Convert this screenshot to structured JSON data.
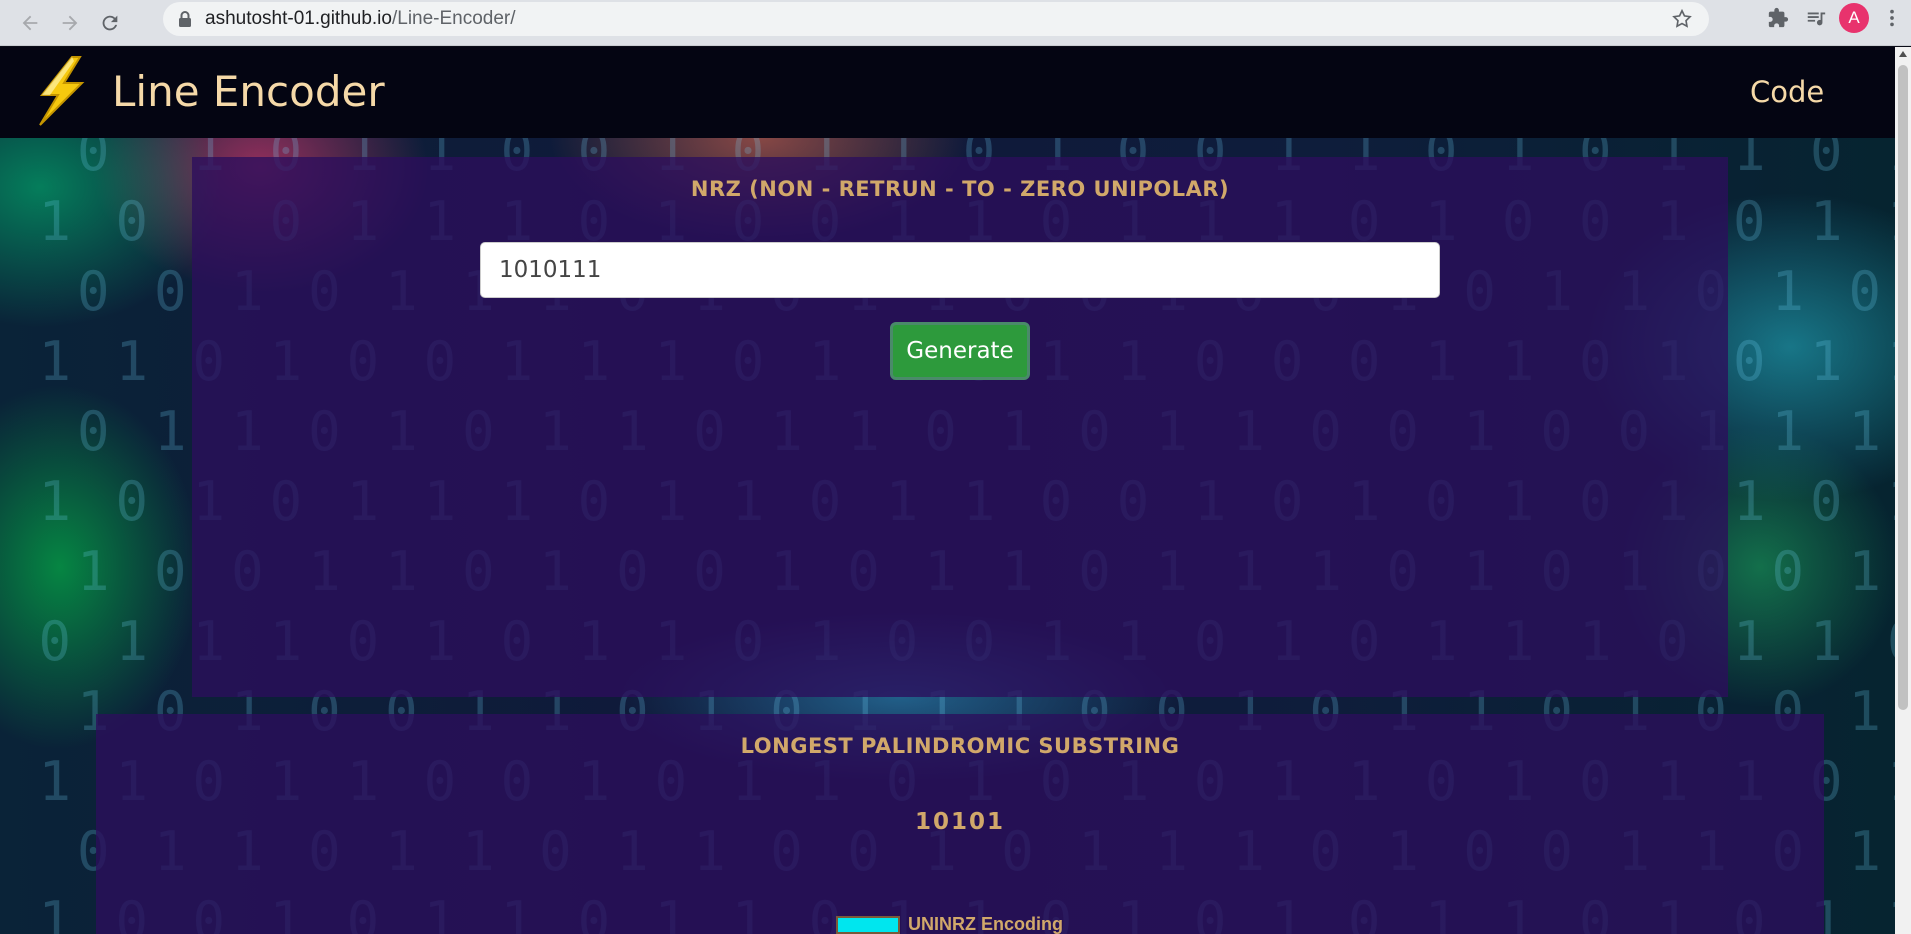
{
  "browser": {
    "url_host": "ashutosht-01.github.io",
    "url_path": "/Line-Encoder/",
    "avatar_letter": "A"
  },
  "navbar": {
    "brand": "Line Encoder",
    "code_link": "Code"
  },
  "encoder": {
    "heading": "NRZ (NON - RETRUN - TO - ZERO UNIPOLAR)",
    "input_value": "1010111",
    "generate_label": "Generate"
  },
  "palindrome": {
    "heading": "LONGEST PALINDROMIC SUBSTRING",
    "result": "10101",
    "legend_label": "UNINRZ Encoding",
    "legend_color": "#00e6ee"
  },
  "colors": {
    "accent_text": "#d1a86a",
    "brand_text": "#f5d9a8",
    "button_green": "#2d9a3c",
    "panel": "#2c0e5c"
  }
}
